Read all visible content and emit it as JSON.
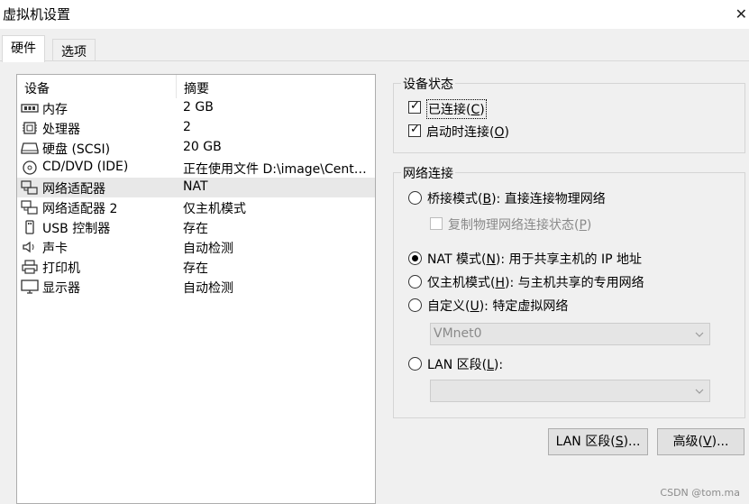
{
  "window": {
    "title": "虚拟机设置"
  },
  "tabs": [
    {
      "label": "硬件"
    },
    {
      "label": "选项"
    }
  ],
  "device_list": {
    "headers": {
      "device": "设备",
      "summary": "摘要"
    },
    "rows": [
      {
        "name": "内存",
        "summary": "2 GB",
        "icon": "memory-icon"
      },
      {
        "name": "处理器",
        "summary": "2",
        "icon": "cpu-icon"
      },
      {
        "name": "硬盘 (SCSI)",
        "summary": "20 GB",
        "icon": "hard-disk-icon"
      },
      {
        "name": "CD/DVD (IDE)",
        "summary": "正在使用文件 D:\\image\\CentOS...",
        "icon": "cd-dvd-icon"
      },
      {
        "name": "网络适配器",
        "summary": "NAT",
        "icon": "network-adapter-icon"
      },
      {
        "name": "网络适配器 2",
        "summary": "仅主机模式",
        "icon": "network-adapter-icon"
      },
      {
        "name": "USB 控制器",
        "summary": "存在",
        "icon": "usb-icon"
      },
      {
        "name": "声卡",
        "summary": "自动检测",
        "icon": "speaker-icon"
      },
      {
        "name": "打印机",
        "summary": "存在",
        "icon": "printer-icon"
      },
      {
        "name": "显示器",
        "summary": "自动检测",
        "icon": "monitor-icon"
      }
    ],
    "selected_index": 4
  },
  "device_status": {
    "title": "设备状态",
    "connected": {
      "text": "已连接(",
      "key": "C",
      "close": ")",
      "checked": true
    },
    "connect_on_power": {
      "text": "启动时连接(",
      "key": "O",
      "close": ")",
      "checked": true
    }
  },
  "network_connection": {
    "title": "网络连接",
    "bridged": {
      "text": "桥接模式(",
      "key": "B",
      "rest": "): 直接连接物理网络"
    },
    "replicate": {
      "text": "复制物理网络连接状态(",
      "key": "P",
      "close": ")"
    },
    "nat": {
      "text": "NAT 模式(",
      "key": "N",
      "rest": "): 用于共享主机的 IP 地址"
    },
    "host_only": {
      "text": "仅主机模式(",
      "key": "H",
      "rest": "): 与主机共享的专用网络"
    },
    "custom": {
      "text": "自定义(",
      "key": "U",
      "rest": "): 特定虚拟网络"
    },
    "custom_select": "VMnet0",
    "lan_segment": {
      "text": "LAN 区段(",
      "key": "L",
      "rest": "):"
    },
    "lan_select": "",
    "selected": "nat"
  },
  "buttons": {
    "lan_segments": {
      "text": "LAN 区段(",
      "key": "S",
      "rest": ")..."
    },
    "advanced": {
      "text": "高级(",
      "key": "V",
      "rest": ")..."
    }
  },
  "watermark": "CSDN @tom.ma"
}
